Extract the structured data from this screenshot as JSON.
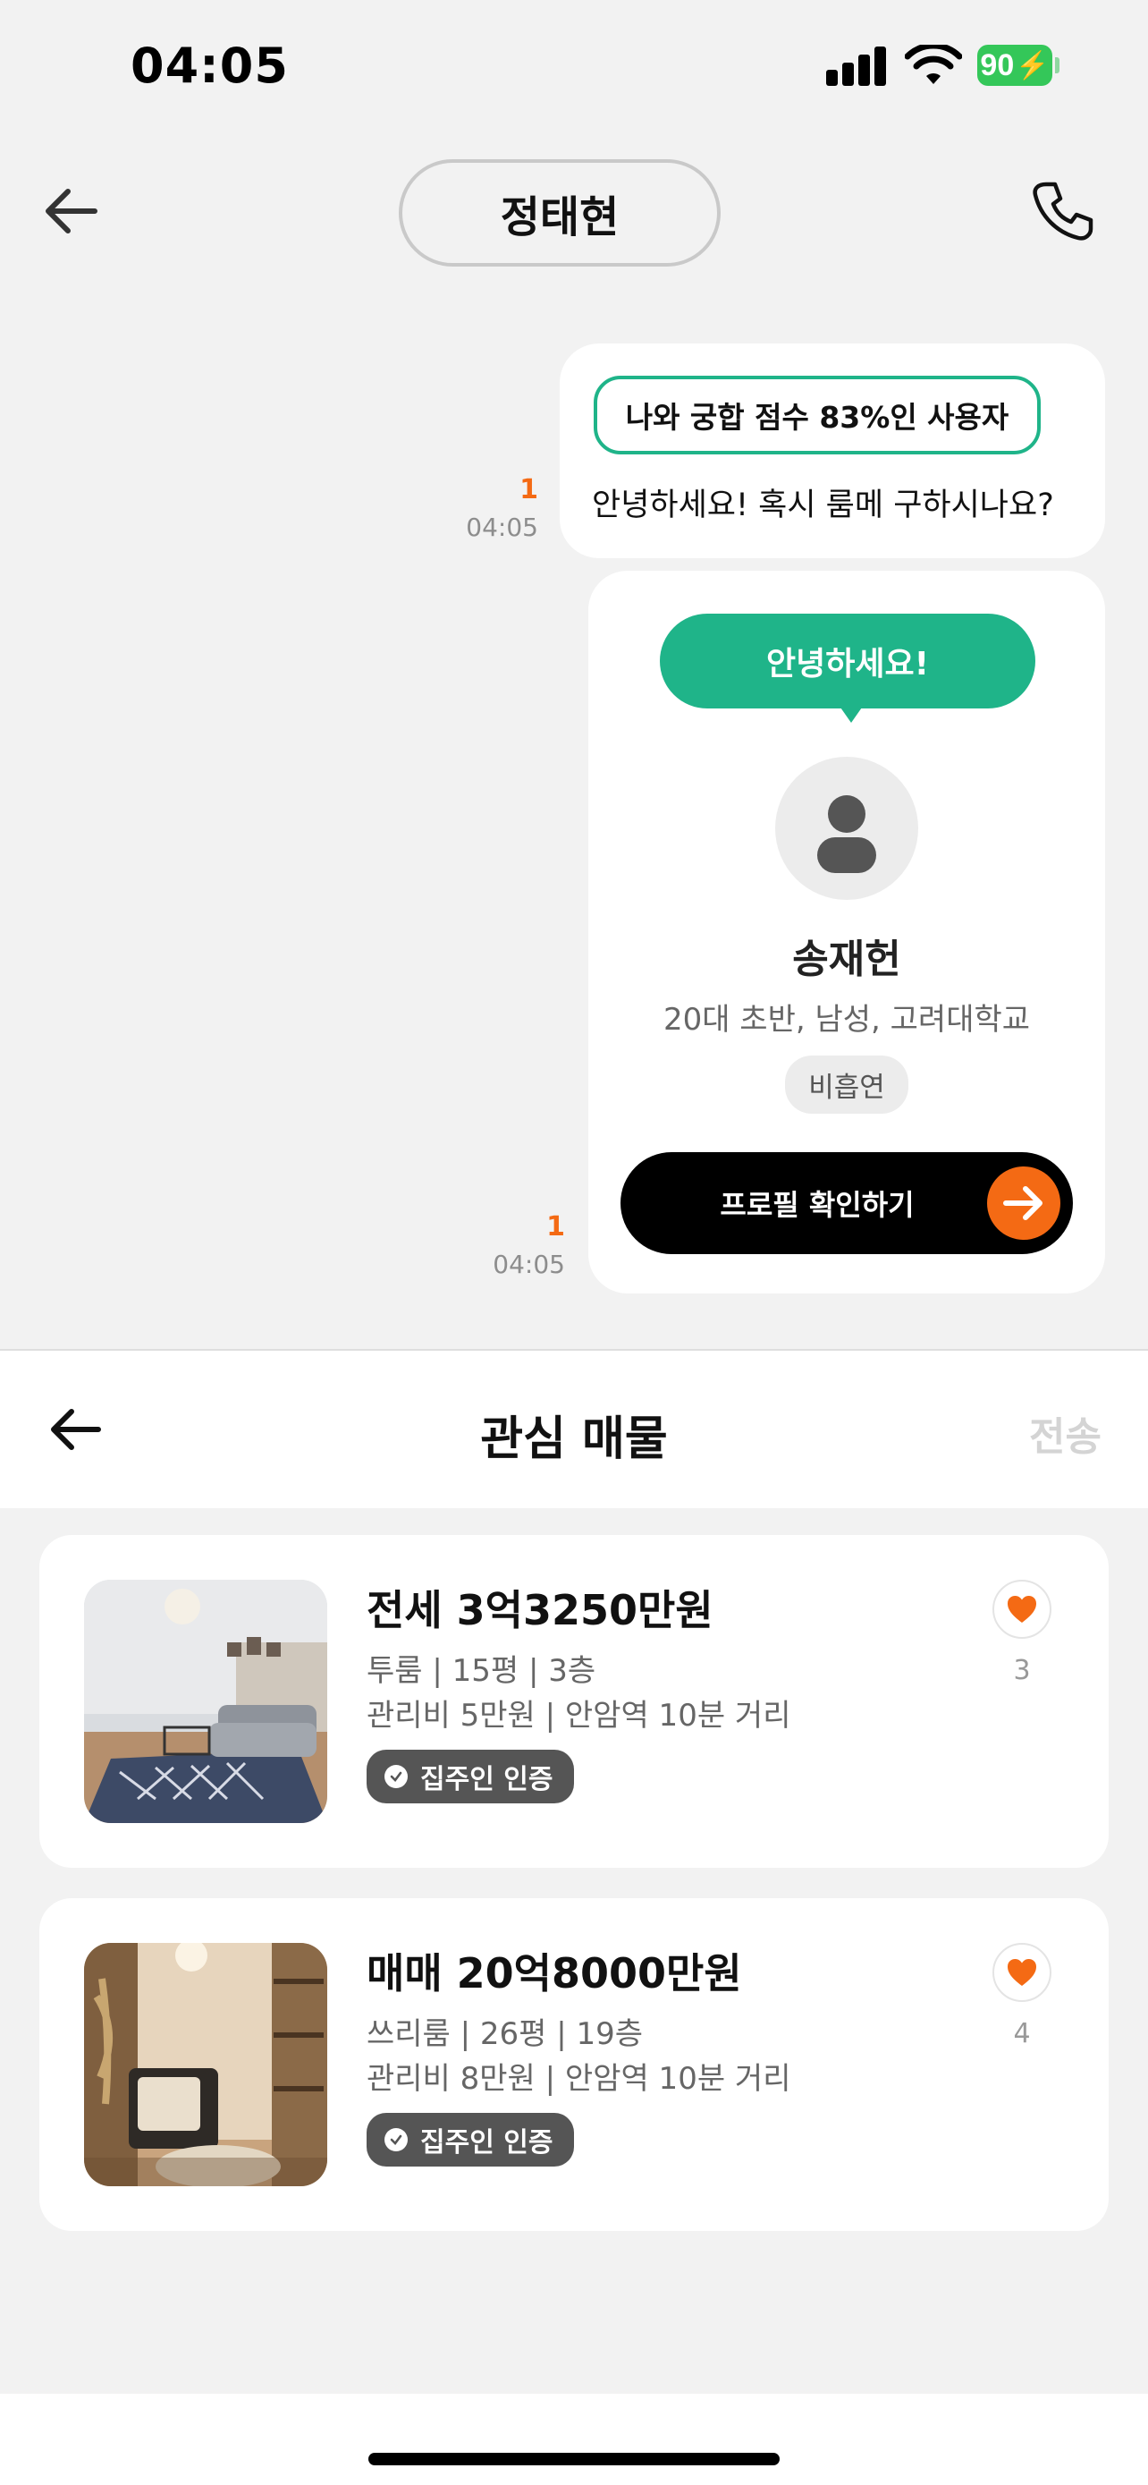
{
  "status_bar": {
    "time": "04:05",
    "battery": "90"
  },
  "chat": {
    "title": "정태현",
    "messages": [
      {
        "compat_label": "나와 궁합 점수 83%인 사용자",
        "text": "안녕하세요! 혹시 룸메 구하시나요?",
        "read_count": "1",
        "time": "04:05"
      },
      {
        "greeting": "안녕하세요!",
        "profile_name": "송재헌",
        "profile_info": "20대 초반, 남성, 고려대학교",
        "tag": "비흡연",
        "button_label": "프로필 확인하기",
        "read_count": "1",
        "time": "04:05"
      }
    ]
  },
  "sheet": {
    "title": "관심 매물",
    "send_label": "전송",
    "listings": [
      {
        "price": "전세 3억3250만원",
        "info": "투룸 | 15평 | 3층",
        "info2": "관리비 5만원 | 안암역 10분 거리",
        "badge": "집주인 인증",
        "likes": "3"
      },
      {
        "price": "매매 20억8000만원",
        "info": "쓰리룸 | 26평 | 19층",
        "info2": "관리비 8만원 | 안암역 10분 거리",
        "badge": "집주인 인증",
        "likes": "4"
      }
    ]
  },
  "colors": {
    "accent_green": "#1fb489",
    "accent_orange": "#f46a14",
    "background": "#f2f2f2"
  }
}
